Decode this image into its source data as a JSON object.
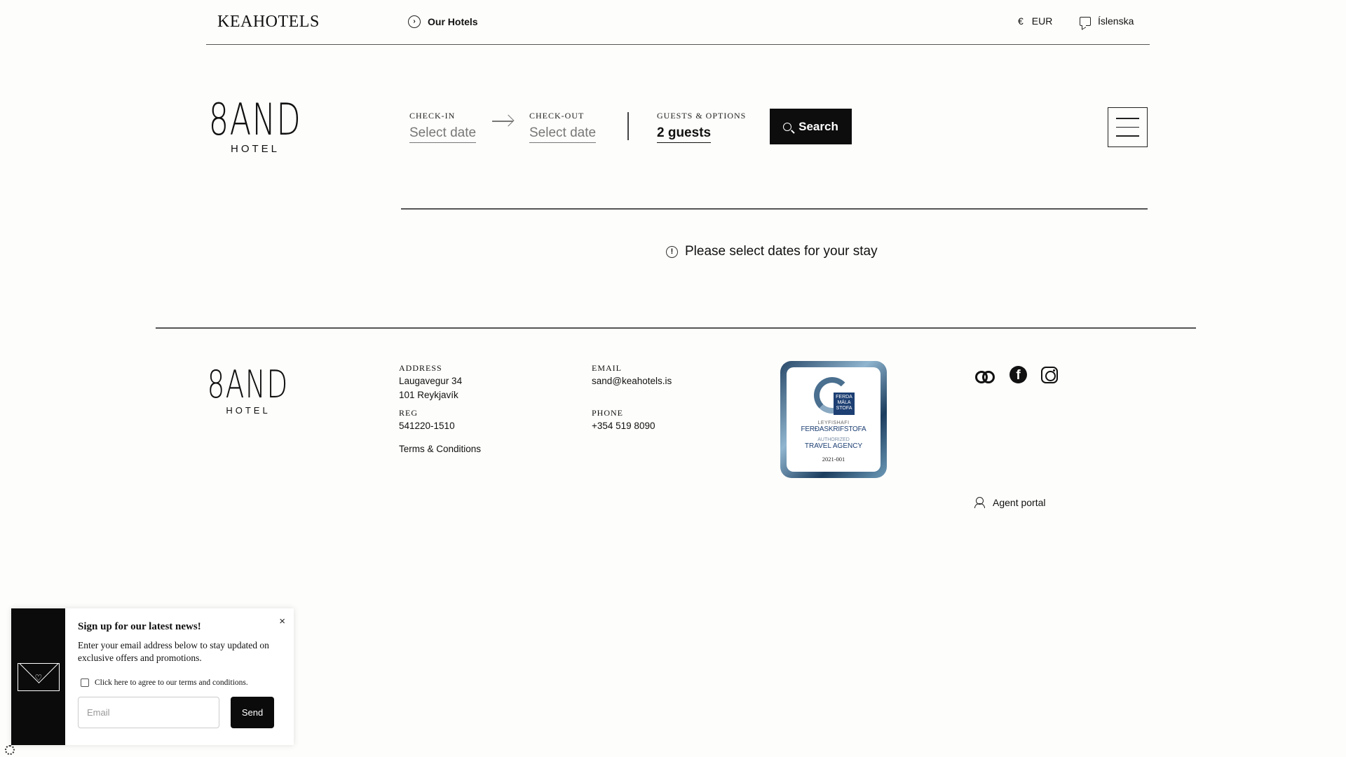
{
  "topbar": {
    "brand": "KEAHOTELS",
    "our_hotels": "Our Hotels",
    "currency_symbol": "€",
    "currency": "EUR",
    "language": "Íslenska"
  },
  "logo": {
    "word": "8AND",
    "sub": "HOTEL"
  },
  "booking": {
    "checkin_label": "CHECK-IN",
    "checkin_value": "Select date",
    "checkout_label": "CHECK-OUT",
    "checkout_value": "Select date",
    "guests_label": "GUESTS & OPTIONS",
    "guests_value": "2 guests",
    "search_label": "Search"
  },
  "notice": "Please select dates for your stay",
  "footer": {
    "address_label": "ADDRESS",
    "address_line1": "Laugavegur 34",
    "address_line2": "101 Reykjavík",
    "reg_label": "REG",
    "reg_value": "541220-1510",
    "terms": "Terms & Conditions",
    "email_label": "EMAIL",
    "email_value": "sand@keahotels.is",
    "phone_label": "PHONE",
    "phone_value": "+354 519 8090",
    "agent_portal": "Agent portal",
    "badge": {
      "box_text": "FERDA MÁLA STOFA",
      "line1": "LEYFISHAFI",
      "line2": "FERÐASKRIFSTOFA",
      "line3": "AUTHORIZED",
      "line4": "TRAVEL AGENCY",
      "line5": "2021-001"
    }
  },
  "popup": {
    "title": "Sign up for our latest news!",
    "text": "Enter your email address below to stay updated on exclusive offers and promotions.",
    "agree": "Click here to agree to our terms and conditions.",
    "email_placeholder": "Email",
    "send": "Send",
    "close": "×"
  }
}
